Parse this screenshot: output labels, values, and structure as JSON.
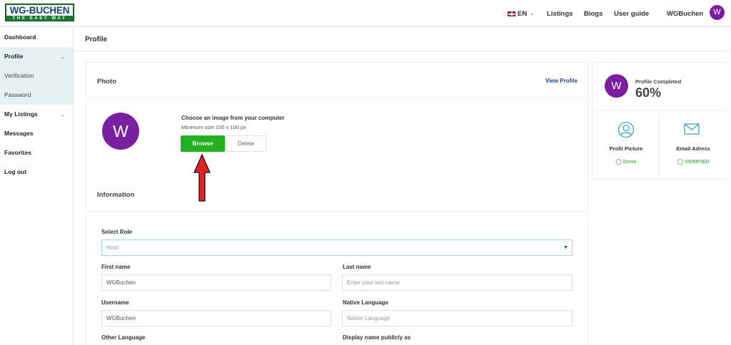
{
  "logo": {
    "line1": "WG-BUCHEN",
    "line2": "THE EASY WAY"
  },
  "header": {
    "language": "EN",
    "nav": [
      "Listings",
      "Blogs",
      "User guide"
    ],
    "username": "WGBuchen",
    "avatar_letter": "W"
  },
  "sidebar": {
    "items": [
      {
        "label": "Dashboard"
      },
      {
        "label": "Profile"
      },
      {
        "label": "Verification"
      },
      {
        "label": "Password"
      },
      {
        "label": "My Listings"
      },
      {
        "label": "Messages"
      },
      {
        "label": "Favorites"
      },
      {
        "label": "Log out"
      }
    ]
  },
  "page": {
    "title": "Profile"
  },
  "photo": {
    "title": "Photo",
    "view_profile": "View Profile",
    "avatar_letter": "W",
    "choose_text": "Choose an image from your computer",
    "min_size": "Minimum size 100 x 100 px",
    "browse_label": "Browse",
    "delete_label": "Delete"
  },
  "information": {
    "title": "Information",
    "select_role_label": "Select Role",
    "select_role_value": "Host",
    "first_name_label": "First name",
    "first_name_value": "WGBuchen",
    "last_name_label": "Last name",
    "last_name_placeholder": "Enter your last name",
    "username_label": "Username",
    "username_value": "WGBuchen",
    "native_language_label": "Native Language",
    "native_language_placeholder": "Native Language",
    "other_language_label": "Other Language",
    "display_name_label": "Display name publicly as"
  },
  "profile_card": {
    "avatar_letter": "W",
    "completed_label": "Profile Completed",
    "completed_value": "60%",
    "stats": [
      {
        "label": "Profil Picture",
        "status": "Done",
        "icon": "user-circle-icon"
      },
      {
        "label": "Email Adress",
        "status": "VERIFIED",
        "icon": "envelope-icon"
      }
    ]
  },
  "colors": {
    "accent_purple": "#7b1fa2",
    "browse_green": "#22b21f",
    "status_green": "#5cb85c",
    "sidebar_active": "#e4f2f6",
    "link_blue": "#1a4a8c",
    "icon_teal": "#3aa3c7",
    "arrow_red": "#e32222"
  }
}
